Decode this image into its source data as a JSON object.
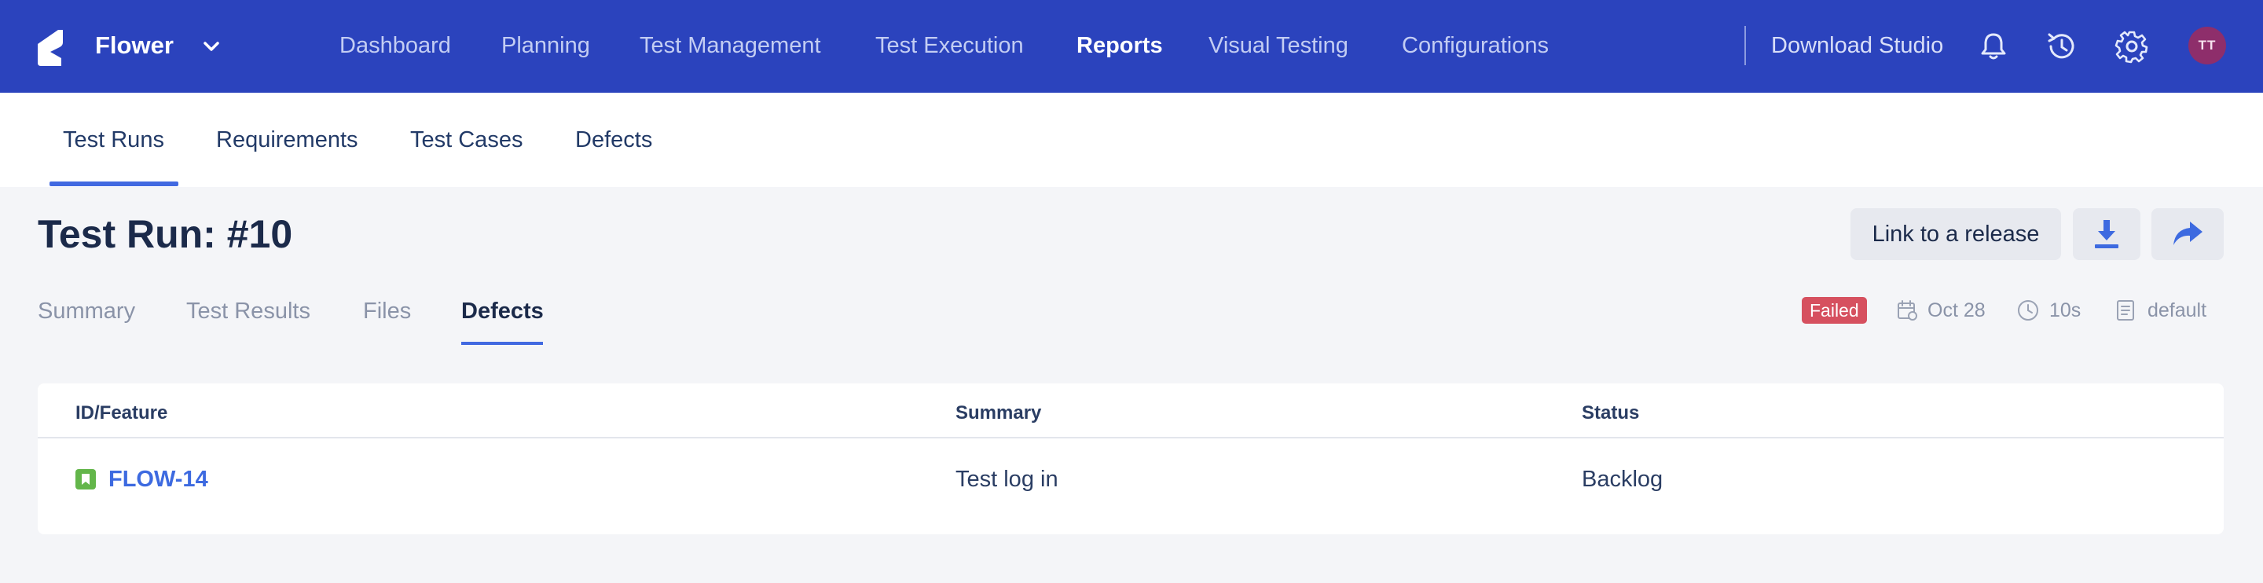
{
  "app": {
    "name": "Flower",
    "brand_color": "#2b43bd"
  },
  "topnav": {
    "items": [
      {
        "label": "Dashboard",
        "active": false
      },
      {
        "label": "Planning",
        "active": false
      },
      {
        "label": "Test Management",
        "active": false
      },
      {
        "label": "Test Execution",
        "active": false
      },
      {
        "label": "Reports",
        "active": true
      },
      {
        "label": "Visual Testing",
        "active": false
      },
      {
        "label": "Configurations",
        "active": false
      }
    ],
    "download_label": "Download Studio",
    "icons": [
      "bell-icon",
      "history-icon",
      "gear-icon"
    ],
    "avatar_initials": "TT"
  },
  "subnav": {
    "items": [
      {
        "label": "Test Runs",
        "active": true
      },
      {
        "label": "Requirements",
        "active": false
      },
      {
        "label": "Test Cases",
        "active": false
      },
      {
        "label": "Defects",
        "active": false
      }
    ]
  },
  "page": {
    "title": "Test Run: #10",
    "link_release_label": "Link to a release",
    "action_icons": [
      "download-icon",
      "share-icon"
    ]
  },
  "tabs": [
    {
      "label": "Summary",
      "active": false
    },
    {
      "label": "Test Results",
      "active": false
    },
    {
      "label": "Files",
      "active": false
    },
    {
      "label": "Defects",
      "active": true
    }
  ],
  "meta": {
    "status": "Failed",
    "status_color": "#d6505f",
    "date": "Oct 28",
    "duration": "10s",
    "profile": "default"
  },
  "table": {
    "columns": [
      "ID/Feature",
      "Summary",
      "Status"
    ],
    "rows": [
      {
        "id": "FLOW-14",
        "summary": "Test log in",
        "status": "Backlog",
        "type_icon": "story-icon"
      }
    ]
  },
  "accent_color": "#4169e1"
}
